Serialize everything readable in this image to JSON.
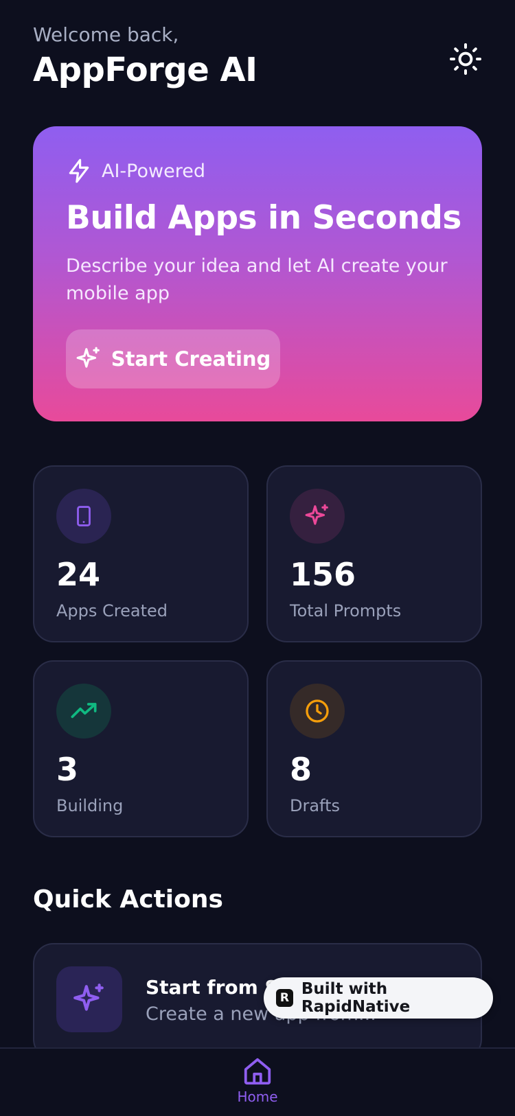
{
  "header": {
    "greeting": "Welcome back,",
    "app_name": "AppForge AI"
  },
  "hero": {
    "tag": "AI-Powered",
    "title": "Build Apps in Seconds",
    "description": "Describe your idea and let AI create your mobile app",
    "button_label": "Start Creating"
  },
  "stats": [
    {
      "value": "24",
      "label": "Apps Created",
      "icon": "phone-icon",
      "color": "#8f5ef0"
    },
    {
      "value": "156",
      "label": "Total Prompts",
      "icon": "sparkles-icon",
      "color": "#ec4899"
    },
    {
      "value": "3",
      "label": "Building",
      "icon": "trending-up-icon",
      "color": "#10b981"
    },
    {
      "value": "8",
      "label": "Drafts",
      "icon": "clock-icon",
      "color": "#f59e0b"
    }
  ],
  "quick_actions": {
    "title": "Quick Actions",
    "items": [
      {
        "title": "Start from Scratch",
        "subtitle": "Create a new app from...",
        "icon": "sparkles-icon"
      }
    ]
  },
  "badge": {
    "label": "Built with RapidNative"
  },
  "tabbar": {
    "home_label": "Home"
  },
  "colors": {
    "background": "#0d0f1e",
    "card": "#181a30",
    "accent": "#8f5ef0",
    "pink": "#ec4899"
  }
}
